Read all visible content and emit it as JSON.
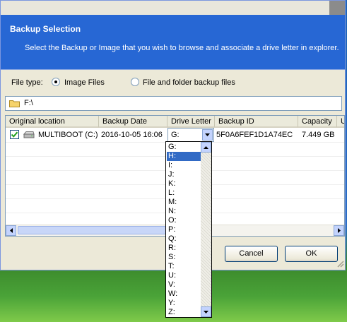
{
  "header": {
    "title": "Backup Selection",
    "subtitle": "Select the Backup or Image that you wish to browse and associate a drive letter in explorer."
  },
  "file_type": {
    "label": "File type:",
    "options": [
      {
        "label": "Image Files",
        "checked": true
      },
      {
        "label": "File and folder backup files",
        "checked": false
      }
    ]
  },
  "path": {
    "value": "F:\\",
    "icon": "folder-icon"
  },
  "table": {
    "columns": [
      "Original location",
      "Backup Date",
      "Drive Letter",
      "Backup ID",
      "Capacity",
      "U"
    ],
    "rows": [
      {
        "checked": true,
        "icon": "hard-drive-icon",
        "original_location": "MULTIBOOT (C:)",
        "backup_date": "2016-10-05 16:06",
        "drive_letter": "G:",
        "backup_id": "5F0A6FEF1D1A74EC",
        "capacity": "7.449 GB"
      }
    ]
  },
  "dropdown": {
    "options": [
      "G:",
      "H:",
      "I:",
      "J:",
      "K:",
      "L:",
      "M:",
      "N:",
      "O:",
      "P:",
      "Q:",
      "R:",
      "S:",
      "T:",
      "U:",
      "V:",
      "W:",
      "Y:",
      "Z:"
    ],
    "highlighted": "H:"
  },
  "buttons": {
    "cancel": "Cancel",
    "ok": "OK"
  },
  "colors": {
    "header": "#2767d4",
    "selection": "#316ac5",
    "dialog": "#ece9d8"
  }
}
